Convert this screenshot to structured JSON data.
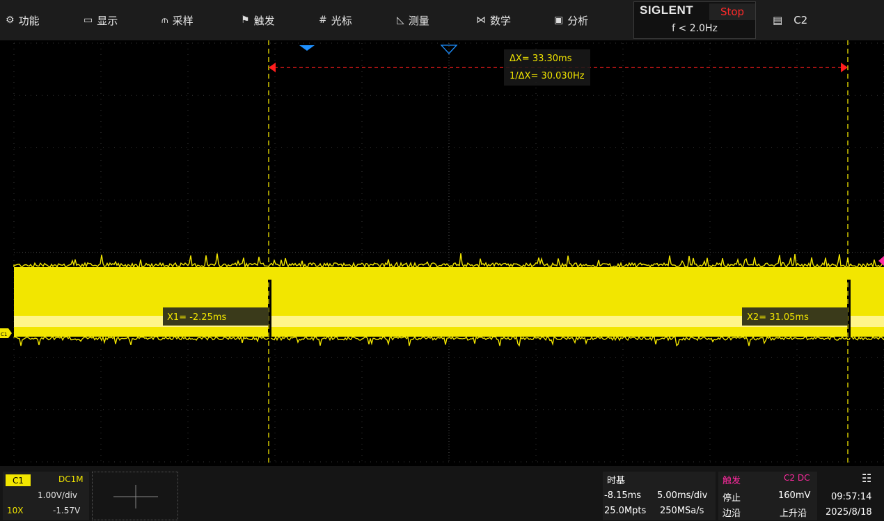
{
  "menu": {
    "items": [
      {
        "icon": "gear-icon",
        "glyph": "⚙",
        "label": "功能"
      },
      {
        "icon": "display-icon",
        "glyph": "▭",
        "label": "显示"
      },
      {
        "icon": "acquire-icon",
        "glyph": "⫙",
        "label": "采样"
      },
      {
        "icon": "trigger-flag-icon",
        "glyph": "⚑",
        "label": "触发"
      },
      {
        "icon": "cursor-icon",
        "glyph": "#",
        "label": "光标"
      },
      {
        "icon": "measure-icon",
        "glyph": "◺",
        "label": "测量"
      },
      {
        "icon": "math-icon",
        "glyph": "⋈",
        "label": "数学"
      },
      {
        "icon": "analysis-icon",
        "glyph": "▣",
        "label": "分析"
      }
    ]
  },
  "brand": {
    "name": "SIGLENT",
    "run_state": "Stop",
    "frequency": "f < 2.0Hz"
  },
  "channel_menu": {
    "icon": "document-icon",
    "label": "C2"
  },
  "cursors": {
    "delta": "ΔX= 33.30ms",
    "inv_delta": "1/ΔX= 30.030Hz",
    "x1_label": "X1= -2.25ms",
    "x2_label": "X2= 31.05ms",
    "x1_ms": -2.25,
    "x2_ms": 31.05
  },
  "waveform": {
    "channel_marker": "C1",
    "color": "#f2e600"
  },
  "c1": {
    "tag": "C1",
    "coupling": "DC1M",
    "scale": "1.00V/div",
    "probe": "10X",
    "offset": "-1.57V"
  },
  "timebase": {
    "title": "时基",
    "delay": "-8.15ms",
    "scale": "5.00ms/div",
    "memory": "25.0Mpts",
    "sample_rate": "250MSa/s"
  },
  "trigger": {
    "title": "触发",
    "source": "C2 DC",
    "mode": "停止",
    "level": "160mV",
    "type": "边沿",
    "slope": "上升沿"
  },
  "clock": {
    "time": "09:57:14",
    "date": "2025/8/18"
  },
  "colors": {
    "trace": "#f2e600",
    "cursor_marker": "#ff1e1e",
    "trigger_pink": "#ff2aa0",
    "marker_blue": "#1e90ff"
  }
}
